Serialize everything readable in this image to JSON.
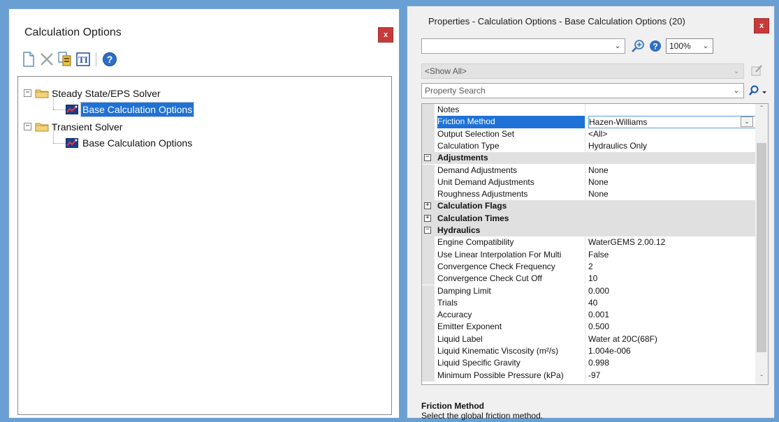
{
  "left_panel": {
    "title": "Calculation Options",
    "close_label": "x",
    "toolbar": [
      "new-icon",
      "delete-icon",
      "duplicate-icon",
      "rename-icon",
      "help-icon"
    ],
    "tree": {
      "steady": {
        "label": "Steady State/EPS Solver",
        "child": "Base Calculation Options"
      },
      "transient": {
        "label": "Transient Solver",
        "child": "Base Calculation Options"
      }
    }
  },
  "right_panel": {
    "title": "Properties - Calculation Options - Base Calculation Options (20)",
    "close_label": "x",
    "element_combo": "",
    "zoom": "100%",
    "filter": "<Show All>",
    "search_placeholder": "Property Search",
    "properties": [
      {
        "name": "Notes",
        "value": ""
      },
      {
        "name": "Friction Method",
        "value": "Hazen-Williams"
      },
      {
        "name": "Output Selection Set",
        "value": "<All>"
      },
      {
        "name": "Calculation Type",
        "value": "Hydraulics Only"
      },
      {
        "name": "Adjustments",
        "category": true,
        "expanded": true
      },
      {
        "name": "Demand Adjustments",
        "value": "None"
      },
      {
        "name": "Unit Demand Adjustments",
        "value": "None"
      },
      {
        "name": "Roughness Adjustments",
        "value": "None"
      },
      {
        "name": "Calculation Flags",
        "category": true,
        "expanded": false
      },
      {
        "name": "Calculation Times",
        "category": true,
        "expanded": false
      },
      {
        "name": "Hydraulics",
        "category": true,
        "expanded": true
      },
      {
        "name": "Engine Compatibility",
        "value": "WaterGEMS 2.00.12"
      },
      {
        "name": "Use Linear Interpolation For Multi",
        "value": "False"
      },
      {
        "name": "Convergence Check Frequency",
        "value": "2"
      },
      {
        "name": "Convergence Check Cut Off",
        "value": "10"
      },
      {
        "name": "Damping Limit",
        "value": "0.000"
      },
      {
        "name": "Trials",
        "value": "40"
      },
      {
        "name": "Accuracy",
        "value": "0.001"
      },
      {
        "name": "Emitter Exponent",
        "value": "0.500"
      },
      {
        "name": "Liquid Label",
        "value": "Water at 20C(68F)"
      },
      {
        "name": "Liquid Kinematic Viscosity (m²/s)",
        "value": "1.004e-006"
      },
      {
        "name": "Liquid Specific Gravity",
        "value": "0.998"
      },
      {
        "name": "Minimum Possible Pressure (kPa)",
        "value": "-97"
      }
    ],
    "selected_property": "Friction Method",
    "description": {
      "title": "Friction Method",
      "text": "Select the global friction method."
    }
  }
}
